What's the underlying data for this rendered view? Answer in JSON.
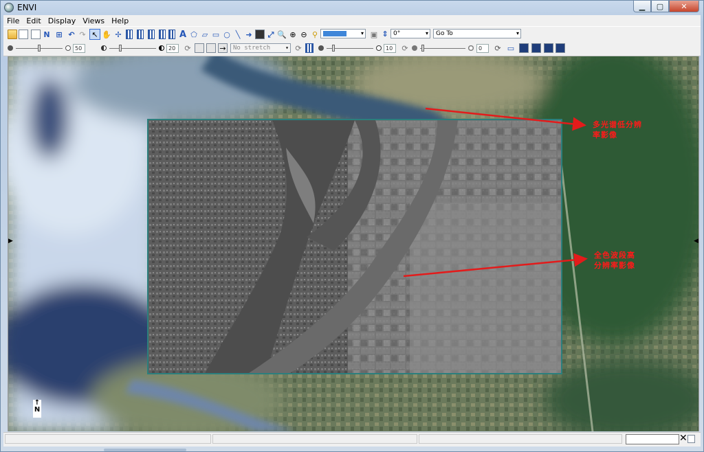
{
  "window": {
    "title": "ENVI"
  },
  "menu": [
    "File",
    "Edit",
    "Display",
    "Views",
    "Help"
  ],
  "toolbar": {
    "rotation_value": "0°",
    "goto_label": "Go To"
  },
  "toolbar2": {
    "brightness_value": "50",
    "contrast_value": "20",
    "stretch_value": "No stretch",
    "sharpen_value": "10",
    "transparency_value": "0"
  },
  "annotations": {
    "multispectral": [
      "多光谱低分辨",
      "率影像"
    ],
    "panchromatic": [
      "全色波段高",
      "分辨率影像"
    ]
  },
  "north_arrow": {
    "glyph": "↑",
    "label": "N"
  },
  "colors": {
    "annotation": "#ff1a1a",
    "frame": "#2b7f7d"
  }
}
